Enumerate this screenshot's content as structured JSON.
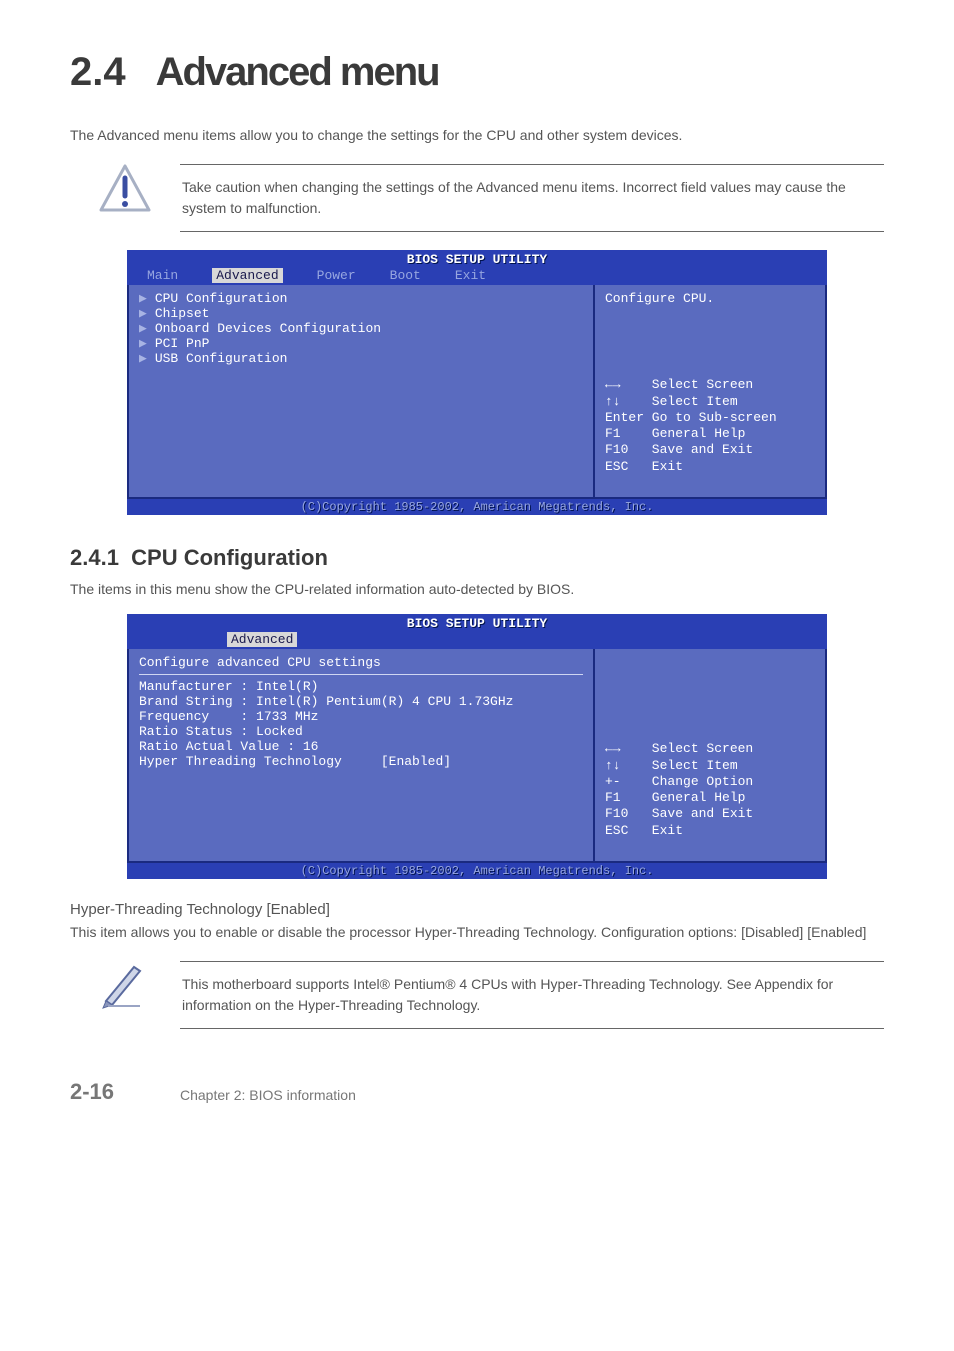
{
  "header": {
    "number": "2.4",
    "title": "Advanced menu"
  },
  "intro": "The Advanced menu items allow you to change the settings for the CPU and other system devices.",
  "caution": "Take caution when changing the settings of the Advanced menu items. Incorrect field values may cause the system to malfunction.",
  "bios_common": {
    "title": "BIOS SETUP UTILITY",
    "copyright": "(C)Copyright 1985-2002, American Megatrends, Inc."
  },
  "bios1": {
    "menus": [
      "Main",
      "Advanced",
      "Power",
      "Boot",
      "Exit"
    ],
    "active_menu": "Advanced",
    "items": [
      "CPU Configuration",
      "Chipset",
      "Onboard Devices Configuration",
      "PCI PnP",
      "USB Configuration"
    ],
    "help_top": "Configure CPU.",
    "help_keys": [
      "←→    Select Screen",
      "↑↓    Select Item",
      "Enter Go to Sub-screen",
      "F1    General Help",
      "F10   Save and Exit",
      "ESC   Exit"
    ]
  },
  "cpu_config": {
    "heading_num": "2.4.1",
    "heading_text": "CPU Configuration",
    "desc": "The items in this menu show the CPU-related information auto-detected by BIOS."
  },
  "bios2": {
    "active_menu": "Advanced",
    "panel_title": "Configure advanced CPU settings",
    "lines": [
      "Manufacturer : Intel(R)",
      "Brand String : Intel(R) Pentium(R) 4 CPU 1.73GHz",
      "Frequency    : 1733 MHz",
      "",
      "Ratio Status : Locked",
      "Ratio Actual Value : 16",
      "",
      "Hyper Threading Technology     [Enabled]"
    ],
    "help_keys": [
      "←→    Select Screen",
      "↑↓    Select Item",
      "+-    Change Option",
      "F1    General Help",
      "F10   Save and Exit",
      "ESC   Exit"
    ]
  },
  "hyper": {
    "title": "Hyper-Threading Technology [Enabled]",
    "desc": "This item allows you to enable or disable the processor Hyper-Threading Technology. Configuration options: [Disabled] [Enabled]"
  },
  "note": "This motherboard supports Intel® Pentium® 4 CPUs with Hyper-Threading Technology. See Appendix for information on the Hyper-Threading Technology.",
  "footer": {
    "page": "2-16",
    "chapter": "Chapter 2:  BIOS information"
  }
}
